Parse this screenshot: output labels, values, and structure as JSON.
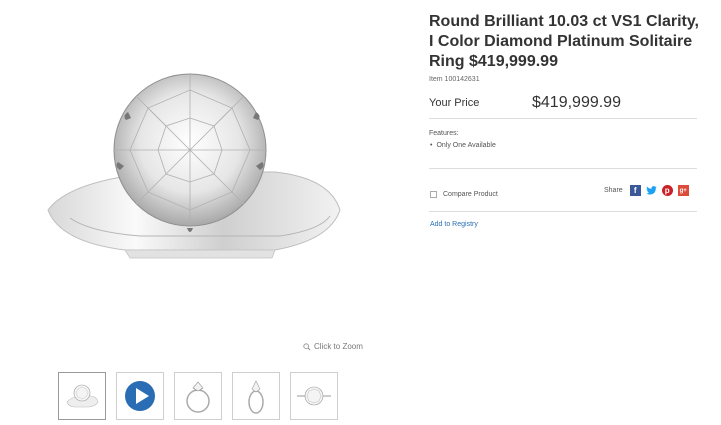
{
  "product": {
    "title": "Round Brilliant 10.03 ct VS1 Clarity, I Color Diamond Platinum Solitaire Ring $419,999.99",
    "item_number": "Item 100142631",
    "price_label": "Your Price",
    "price": "$419,999.99",
    "features_label": "Features:",
    "features": [
      "Only One Available"
    ]
  },
  "gallery": {
    "zoom_label": "Click to Zoom",
    "thumbnails": [
      {
        "kind": "front-view"
      },
      {
        "kind": "video-play"
      },
      {
        "kind": "side-view"
      },
      {
        "kind": "profile-view"
      },
      {
        "kind": "top-view"
      }
    ]
  },
  "actions": {
    "compare_label": "Compare Product",
    "share_label": "Share",
    "registry_label": "Add to Registry",
    "social_icons": [
      "facebook-icon",
      "twitter-icon",
      "pinterest-icon",
      "google-plus-icon"
    ]
  },
  "colors": {
    "play_button": "#2a6db5",
    "link": "#2a6db5",
    "facebook": "#3b5998",
    "twitter": "#1da1f2",
    "pinterest": "#cb2027",
    "google_plus": "#dd4b39"
  }
}
